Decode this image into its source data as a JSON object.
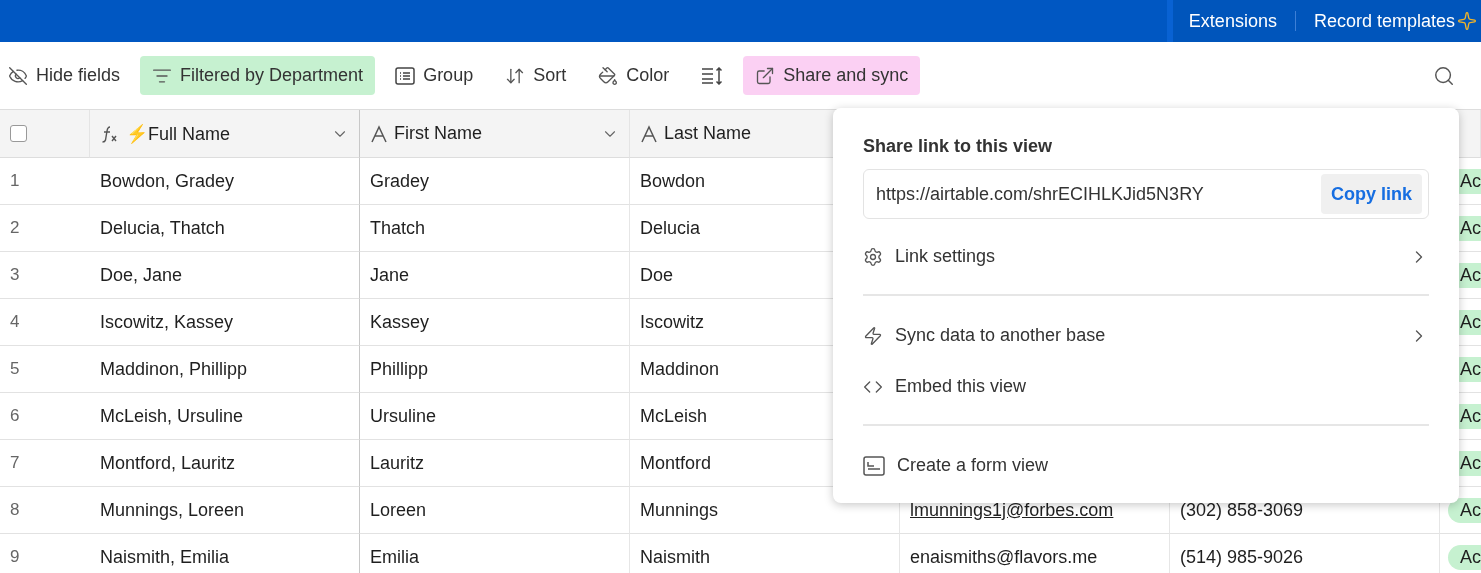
{
  "top_bar": {
    "links": [
      "Extensions",
      "Record templates"
    ]
  },
  "toolbar": {
    "items": [
      {
        "kind": "hide",
        "label": "Hide fields"
      },
      {
        "kind": "filter",
        "label": "Filtered by Department",
        "color": "#c6f1d0"
      },
      {
        "kind": "group",
        "label": "Group"
      },
      {
        "kind": "sort",
        "label": "Sort"
      },
      {
        "kind": "color",
        "label": "Color"
      },
      {
        "kind": "rowheight"
      },
      {
        "kind": "share",
        "label": "Share and sync",
        "color": "#fbd0f3"
      }
    ]
  },
  "table": {
    "select_all": {
      "checked": false
    },
    "columns": [
      {
        "kind": "formula",
        "label": "⚡Full Name"
      },
      {
        "kind": "text",
        "label": "First Name"
      },
      {
        "kind": "text",
        "label": "Last Name"
      }
    ],
    "rows": [
      {
        "number": "1",
        "full_name": "Bowdon, Gradey",
        "first_name": "Gradey",
        "last_name": "Bowdon",
        "status": "Ac"
      },
      {
        "number": "2",
        "full_name": "Delucia, Thatch",
        "first_name": "Thatch",
        "last_name": "Delucia",
        "status": "Ac"
      },
      {
        "number": "3",
        "full_name": "Doe, Jane",
        "first_name": "Jane",
        "last_name": "Doe",
        "status": "Ac"
      },
      {
        "number": "4",
        "full_name": "Iscowitz, Kassey",
        "first_name": "Kassey",
        "last_name": "Iscowitz",
        "status": "Ac"
      },
      {
        "number": "5",
        "full_name": "Maddinon, Phillipp",
        "first_name": "Phillipp",
        "last_name": "Maddinon",
        "status": "Ac"
      },
      {
        "number": "6",
        "full_name": "McLeish, Ursuline",
        "first_name": "Ursuline",
        "last_name": "McLeish",
        "status": "Ac"
      },
      {
        "number": "7",
        "full_name": "Montford, Lauritz",
        "first_name": "Lauritz",
        "last_name": "Montford",
        "status": "Ac"
      },
      {
        "number": "8",
        "full_name": "Munnings, Loreen",
        "first_name": "Loreen",
        "last_name": "Munnings",
        "email": "lmunnings1j@forbes.com",
        "underlined": true,
        "phone": "(302) 858-3069",
        "status": "Ac"
      },
      {
        "number": "9",
        "full_name": "Naismith, Emilia",
        "first_name": "Emilia",
        "last_name": "Naismith",
        "email": "enaismiths@flavors.me",
        "underlined": false,
        "phone": "(514) 985-9026",
        "status": "Ac"
      }
    ]
  },
  "share_popover": {
    "title": "Share link to this view",
    "url": "https://airtable.com/shrECIHLKJid5N3RY",
    "copy_button": {
      "label": "Copy link",
      "hovered": true
    },
    "sections": [
      [
        {
          "kind": "settings",
          "label": "Link settings",
          "submenu": true
        }
      ],
      [
        {
          "kind": "sync",
          "label": "Sync data to another base",
          "submenu": true
        },
        {
          "kind": "embed",
          "label": "Embed this view",
          "submenu": false
        }
      ],
      [
        {
          "kind": "form",
          "label": "Create a form view",
          "submenu": false
        }
      ]
    ]
  }
}
